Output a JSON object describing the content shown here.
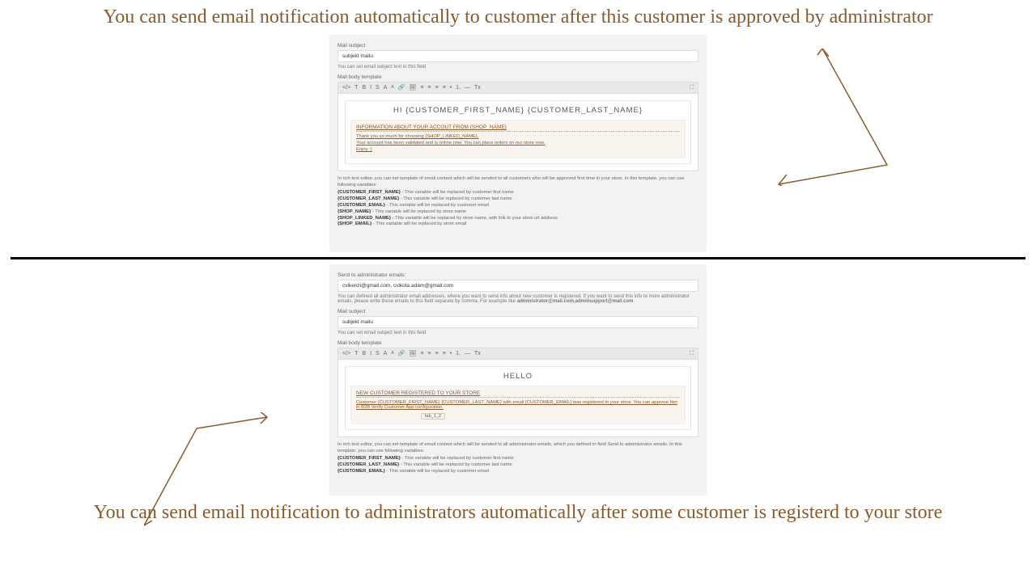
{
  "callouts": {
    "top": "You can send email notification automatically to customer after this customer is approved by administrator",
    "bottom": "You can send email notification to administrators automatically after some customer is registerd to your store"
  },
  "panel1": {
    "subject_label": "Mail subject",
    "subject_value": "subjekt mailu",
    "subject_help": "You can set email subject text in this field",
    "body_label": "Mail body template",
    "greeting": "HI {CUSTOMER_FIRST_NAME} {CUSTOMER_LAST_NAME}",
    "banner_header": "INFORMATION ABOUT YOUR ACCOUT FROM {SHOP_NAME}",
    "banner_line1": "Thank you so much for choosing {SHOP_LINKED_NAME}.",
    "banner_line2": "Your account has been validated and is online now. You can place orders on our store now.",
    "banner_line3": "Enjoy :)",
    "desc": "In rich text editor, you can set template of email content which will be sended to all customers who will be approved first time in your store. In this template, you can use following variables:",
    "v1": "{CUSTOMER_FIRST_NAME}",
    "v1d": " - This variable will be replaced by customer first name",
    "v2": "{CUSTOMER_LAST_NAME}",
    "v2d": " - This variable will be replaced by customer last name",
    "v3": "{CUSTOMER_EMAIL}",
    "v3d": " - This variable will be replaced by customer email",
    "v4": "{SHOP_NAME}",
    "v4d": " - This variable will be replaced by store name",
    "v5": "{SHOP_LINKED_NAME}",
    "v5d": " - This variable will be replaced by store name, with link to your store url address",
    "v6": "{SHOP_EMAIL}",
    "v6d": " - This variable will be replaced by store email"
  },
  "panel2": {
    "admin_label": "Send to administrator emails:",
    "admin_value": "cvikenzi@gmail.com, cvikota.adam@gmail.com",
    "admin_help": "You can defined all administrator email addresses, where you want to send info about new customer is registered. If you want to send this info to more administrator emails, please write these emails to this field separate by comma. For example like",
    "admin_help_bold": "administrator@mail.com,adminsupport@mail.com",
    "subject_label": "Mail subject",
    "subject_value": "subjekt mailu",
    "subject_help": "You can set email subject text in this field",
    "body_label": "Mail body template",
    "greeting": "HELLO",
    "banner_header": "NEW CUSTOMER REGISTERED TO YOUR STORE",
    "banner_line1": "Customer {CUSTOMER_FIRST_NAME} {CUSTOMER_LAST_NAME} with email {CUSTOMER_EMAIL} was registered to your store. You can approve him in B2B Verify Customer App configuration.",
    "tag": "tab_1_2",
    "desc": "In rich text editor, you can set template of email content which will be sended to all administrator emails, which you defined in field Send to administrator emails. In this template, you can use following variables:",
    "v1": "{CUSTOMER_FIRST_NAME}",
    "v1d": " - This variable will be replaced by customer first name",
    "v2": "{CUSTOMER_LAST_NAME}",
    "v2d": " - This variable will be replaced by customer last name",
    "v3": "{CUSTOMER_EMAIL}",
    "v3d": " - This variable will be replaced by customer email"
  },
  "icons": [
    "</>",
    "T",
    "B",
    "I",
    "S",
    "A",
    "A",
    "🔗",
    "🖼",
    "≡",
    "≡",
    "≡",
    "≡",
    "•",
    "1.",
    "—",
    "Tx",
    "⛶"
  ]
}
